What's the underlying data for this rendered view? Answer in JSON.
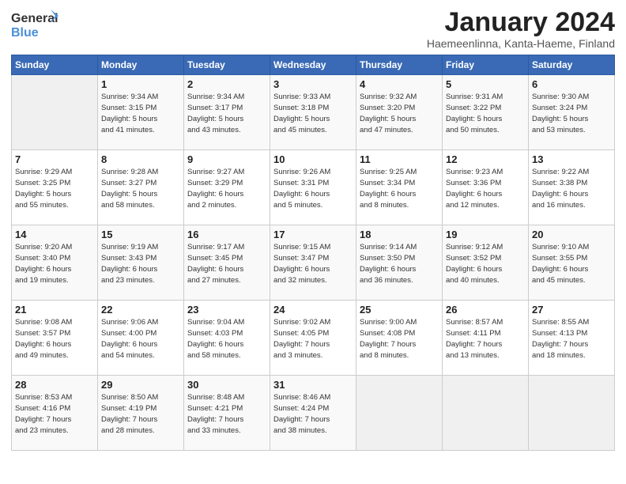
{
  "logo": {
    "text1": "General",
    "text2": "Blue"
  },
  "title": "January 2024",
  "subtitle": "Haemeenlinna, Kanta-Haeme, Finland",
  "headers": [
    "Sunday",
    "Monday",
    "Tuesday",
    "Wednesday",
    "Thursday",
    "Friday",
    "Saturday"
  ],
  "weeks": [
    [
      {
        "num": "",
        "info": ""
      },
      {
        "num": "1",
        "info": "Sunrise: 9:34 AM\nSunset: 3:15 PM\nDaylight: 5 hours\nand 41 minutes."
      },
      {
        "num": "2",
        "info": "Sunrise: 9:34 AM\nSunset: 3:17 PM\nDaylight: 5 hours\nand 43 minutes."
      },
      {
        "num": "3",
        "info": "Sunrise: 9:33 AM\nSunset: 3:18 PM\nDaylight: 5 hours\nand 45 minutes."
      },
      {
        "num": "4",
        "info": "Sunrise: 9:32 AM\nSunset: 3:20 PM\nDaylight: 5 hours\nand 47 minutes."
      },
      {
        "num": "5",
        "info": "Sunrise: 9:31 AM\nSunset: 3:22 PM\nDaylight: 5 hours\nand 50 minutes."
      },
      {
        "num": "6",
        "info": "Sunrise: 9:30 AM\nSunset: 3:24 PM\nDaylight: 5 hours\nand 53 minutes."
      }
    ],
    [
      {
        "num": "7",
        "info": "Sunrise: 9:29 AM\nSunset: 3:25 PM\nDaylight: 5 hours\nand 55 minutes."
      },
      {
        "num": "8",
        "info": "Sunrise: 9:28 AM\nSunset: 3:27 PM\nDaylight: 5 hours\nand 58 minutes."
      },
      {
        "num": "9",
        "info": "Sunrise: 9:27 AM\nSunset: 3:29 PM\nDaylight: 6 hours\nand 2 minutes."
      },
      {
        "num": "10",
        "info": "Sunrise: 9:26 AM\nSunset: 3:31 PM\nDaylight: 6 hours\nand 5 minutes."
      },
      {
        "num": "11",
        "info": "Sunrise: 9:25 AM\nSunset: 3:34 PM\nDaylight: 6 hours\nand 8 minutes."
      },
      {
        "num": "12",
        "info": "Sunrise: 9:23 AM\nSunset: 3:36 PM\nDaylight: 6 hours\nand 12 minutes."
      },
      {
        "num": "13",
        "info": "Sunrise: 9:22 AM\nSunset: 3:38 PM\nDaylight: 6 hours\nand 16 minutes."
      }
    ],
    [
      {
        "num": "14",
        "info": "Sunrise: 9:20 AM\nSunset: 3:40 PM\nDaylight: 6 hours\nand 19 minutes."
      },
      {
        "num": "15",
        "info": "Sunrise: 9:19 AM\nSunset: 3:43 PM\nDaylight: 6 hours\nand 23 minutes."
      },
      {
        "num": "16",
        "info": "Sunrise: 9:17 AM\nSunset: 3:45 PM\nDaylight: 6 hours\nand 27 minutes."
      },
      {
        "num": "17",
        "info": "Sunrise: 9:15 AM\nSunset: 3:47 PM\nDaylight: 6 hours\nand 32 minutes."
      },
      {
        "num": "18",
        "info": "Sunrise: 9:14 AM\nSunset: 3:50 PM\nDaylight: 6 hours\nand 36 minutes."
      },
      {
        "num": "19",
        "info": "Sunrise: 9:12 AM\nSunset: 3:52 PM\nDaylight: 6 hours\nand 40 minutes."
      },
      {
        "num": "20",
        "info": "Sunrise: 9:10 AM\nSunset: 3:55 PM\nDaylight: 6 hours\nand 45 minutes."
      }
    ],
    [
      {
        "num": "21",
        "info": "Sunrise: 9:08 AM\nSunset: 3:57 PM\nDaylight: 6 hours\nand 49 minutes."
      },
      {
        "num": "22",
        "info": "Sunrise: 9:06 AM\nSunset: 4:00 PM\nDaylight: 6 hours\nand 54 minutes."
      },
      {
        "num": "23",
        "info": "Sunrise: 9:04 AM\nSunset: 4:03 PM\nDaylight: 6 hours\nand 58 minutes."
      },
      {
        "num": "24",
        "info": "Sunrise: 9:02 AM\nSunset: 4:05 PM\nDaylight: 7 hours\nand 3 minutes."
      },
      {
        "num": "25",
        "info": "Sunrise: 9:00 AM\nSunset: 4:08 PM\nDaylight: 7 hours\nand 8 minutes."
      },
      {
        "num": "26",
        "info": "Sunrise: 8:57 AM\nSunset: 4:11 PM\nDaylight: 7 hours\nand 13 minutes."
      },
      {
        "num": "27",
        "info": "Sunrise: 8:55 AM\nSunset: 4:13 PM\nDaylight: 7 hours\nand 18 minutes."
      }
    ],
    [
      {
        "num": "28",
        "info": "Sunrise: 8:53 AM\nSunset: 4:16 PM\nDaylight: 7 hours\nand 23 minutes."
      },
      {
        "num": "29",
        "info": "Sunrise: 8:50 AM\nSunset: 4:19 PM\nDaylight: 7 hours\nand 28 minutes."
      },
      {
        "num": "30",
        "info": "Sunrise: 8:48 AM\nSunset: 4:21 PM\nDaylight: 7 hours\nand 33 minutes."
      },
      {
        "num": "31",
        "info": "Sunrise: 8:46 AM\nSunset: 4:24 PM\nDaylight: 7 hours\nand 38 minutes."
      },
      {
        "num": "",
        "info": ""
      },
      {
        "num": "",
        "info": ""
      },
      {
        "num": "",
        "info": ""
      }
    ]
  ]
}
